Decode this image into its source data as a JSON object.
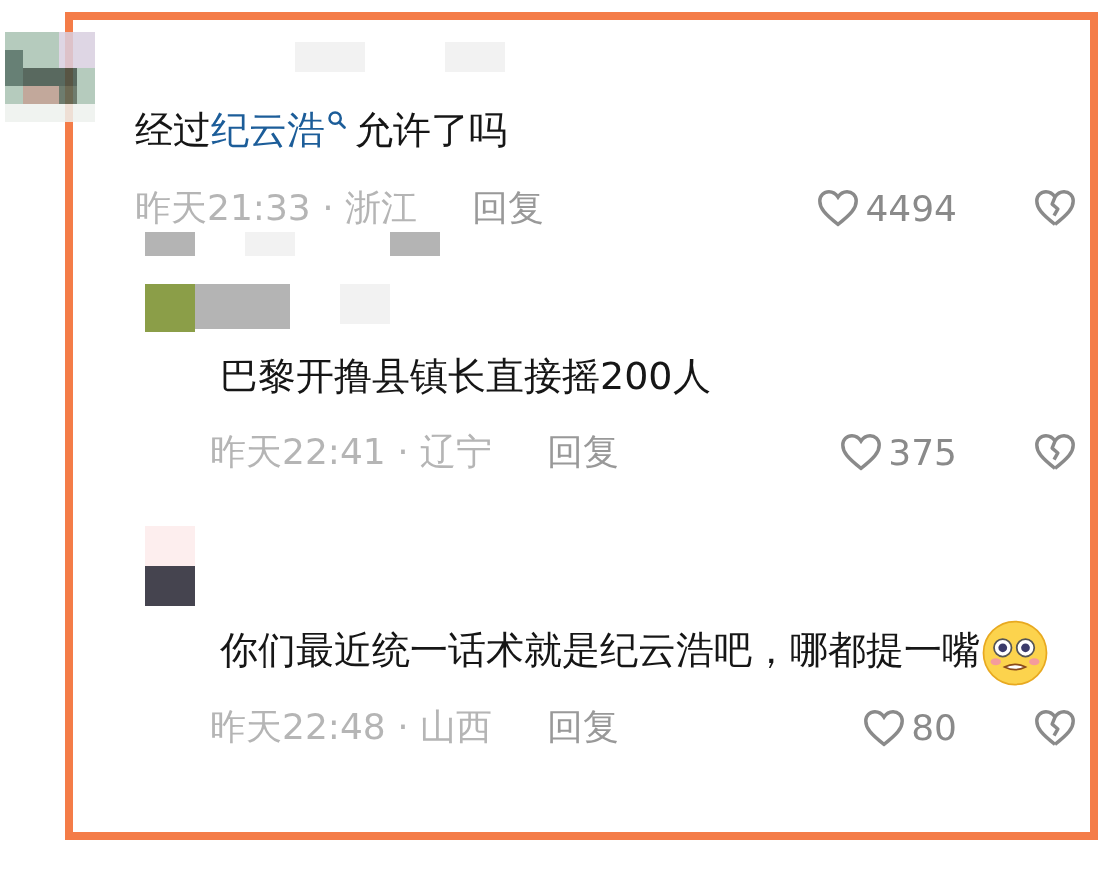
{
  "comments": [
    {
      "segments": [
        {
          "kind": "plain",
          "text": "经过"
        },
        {
          "kind": "link",
          "text": "纪云浩"
        },
        {
          "kind": "plain",
          "text": "允许了吗"
        }
      ],
      "meta": "昨天21:33 · 浙江",
      "reply_label": "回复",
      "likes": "4494",
      "replies": [
        {
          "segments": [
            {
              "kind": "plain",
              "text": "巴黎开撸县镇长直接摇200人"
            }
          ],
          "meta": "昨天22:41 · 辽宁",
          "reply_label": "回复",
          "likes": "375"
        },
        {
          "segments": [
            {
              "kind": "plain",
              "text": "你们最近统一话术就是纪云浩吧，哪都提一嘴"
            },
            {
              "kind": "emoji"
            }
          ],
          "meta": "昨天22:48 · 山西",
          "reply_label": "回复",
          "likes": "80"
        }
      ]
    }
  ]
}
